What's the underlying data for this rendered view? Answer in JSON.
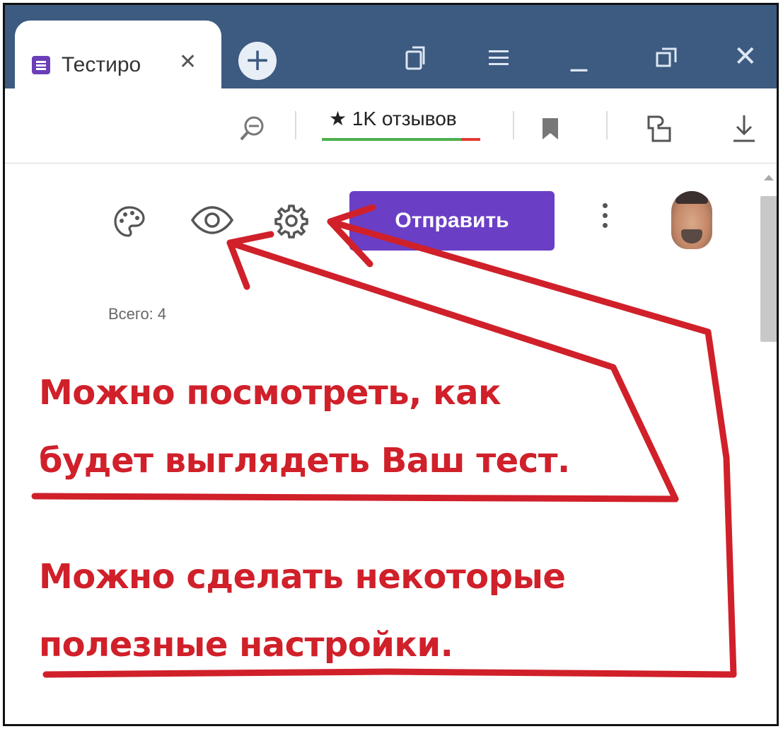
{
  "browser": {
    "tab_title": "Тестиро",
    "tab_close": "✕",
    "new_tab": "+",
    "minimize": "_",
    "close": "✕",
    "reviews_label": "★ 1K отзывов"
  },
  "form_toolbar": {
    "send_label": "Отправить",
    "total_label": "Всего: 4"
  },
  "annotations": {
    "line1": "Можно посмотреть, как",
    "line2": "будет выглядеть Ваш тест.",
    "line3": "Можно сделать некоторые",
    "line4": "полезные настройки."
  },
  "colors": {
    "tab_strip": "#3d5a80",
    "send_button": "#6a3fc5",
    "annotation_red": "#d0202a"
  }
}
